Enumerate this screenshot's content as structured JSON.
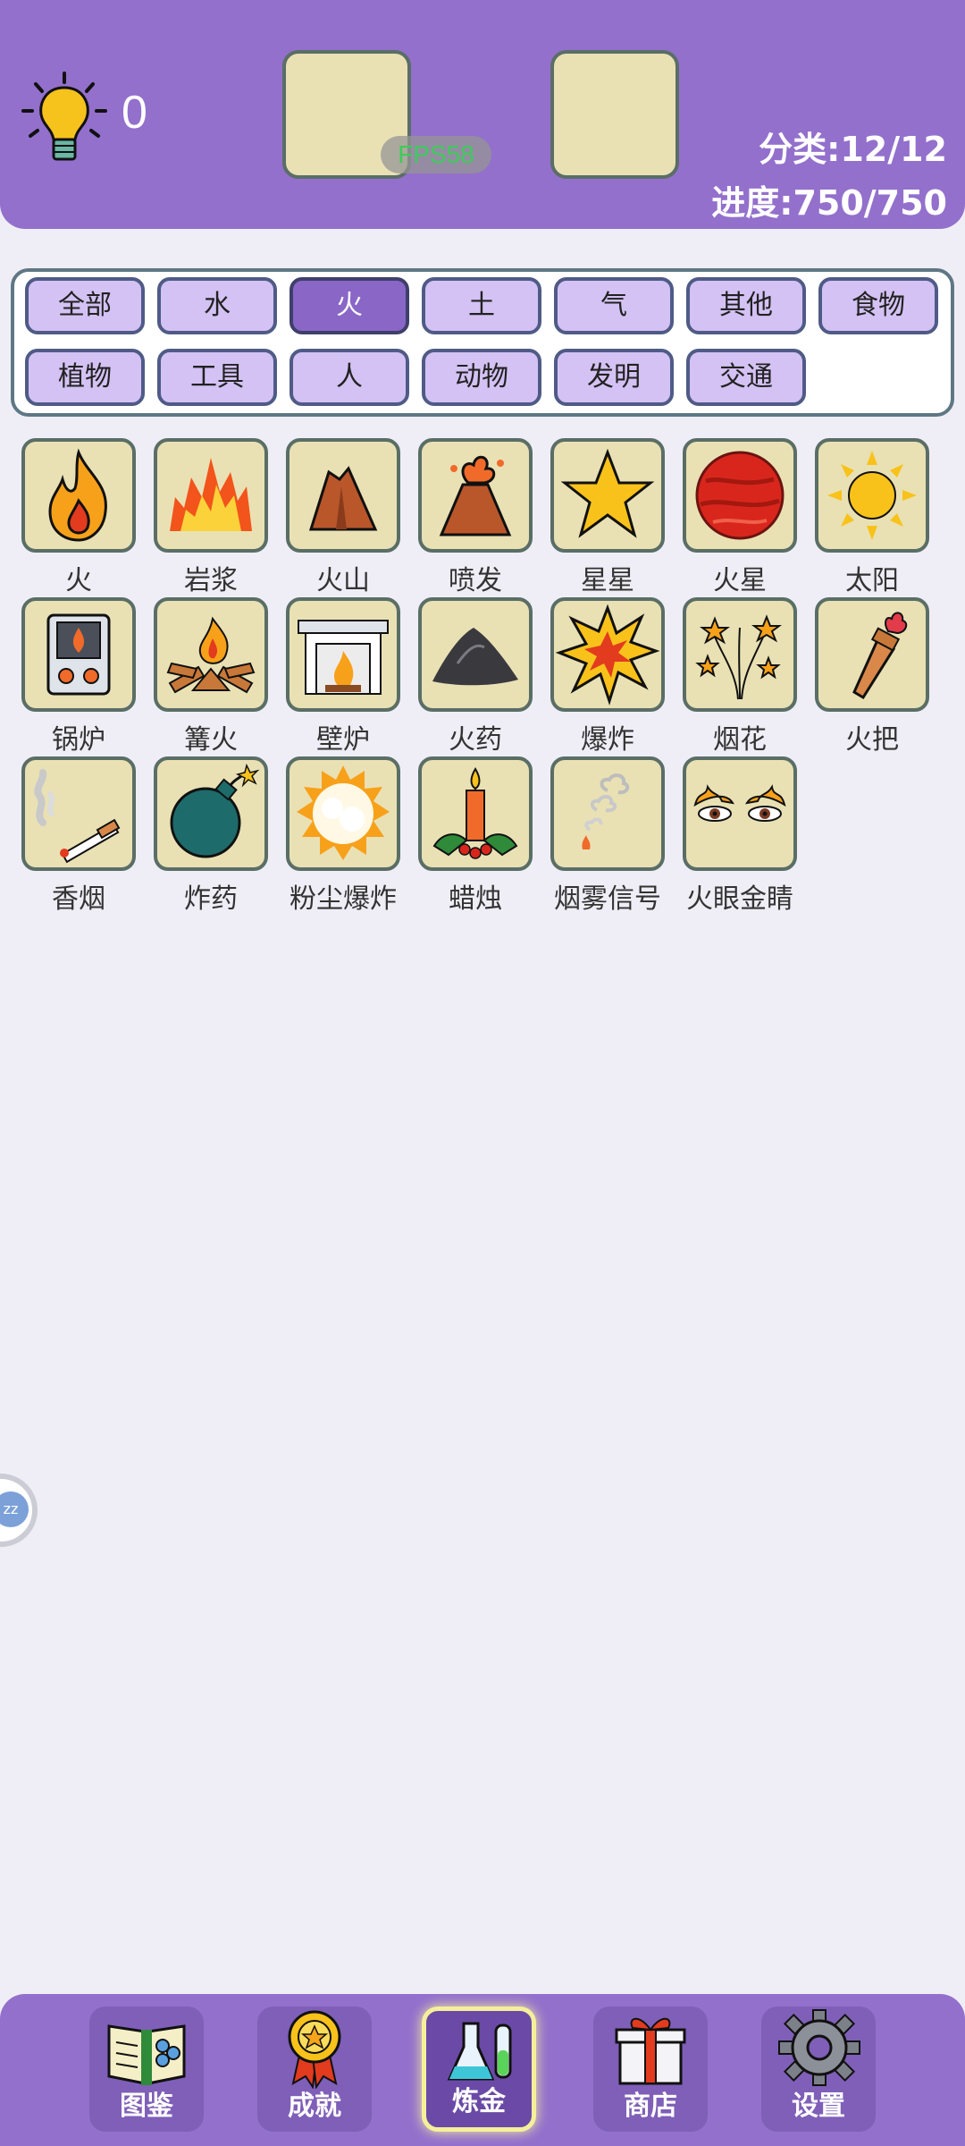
{
  "header": {
    "hint_count": "0",
    "fps": "FPS58",
    "category_stat": "分类:12/12",
    "progress_stat": "进度:750/750"
  },
  "filters": [
    {
      "label": "全部",
      "active": false
    },
    {
      "label": "水",
      "active": false
    },
    {
      "label": "火",
      "active": true
    },
    {
      "label": "土",
      "active": false
    },
    {
      "label": "气",
      "active": false
    },
    {
      "label": "其他",
      "active": false
    },
    {
      "label": "食物",
      "active": false
    },
    {
      "label": "植物",
      "active": false
    },
    {
      "label": "工具",
      "active": false
    },
    {
      "label": "人",
      "active": false
    },
    {
      "label": "动物",
      "active": false
    },
    {
      "label": "发明",
      "active": false
    },
    {
      "label": "交通",
      "active": false
    }
  ],
  "items": [
    {
      "label": "火",
      "icon": "fire-icon"
    },
    {
      "label": "岩浆",
      "icon": "lava-icon"
    },
    {
      "label": "火山",
      "icon": "volcano-icon"
    },
    {
      "label": "喷发",
      "icon": "eruption-icon"
    },
    {
      "label": "星星",
      "icon": "star-icon"
    },
    {
      "label": "火星",
      "icon": "mars-icon"
    },
    {
      "label": "太阳",
      "icon": "sun-icon"
    },
    {
      "label": "锅炉",
      "icon": "boiler-icon"
    },
    {
      "label": "篝火",
      "icon": "campfire-icon"
    },
    {
      "label": "壁炉",
      "icon": "fireplace-icon"
    },
    {
      "label": "火药",
      "icon": "gunpowder-icon"
    },
    {
      "label": "爆炸",
      "icon": "explosion-icon"
    },
    {
      "label": "烟花",
      "icon": "fireworks-icon"
    },
    {
      "label": "火把",
      "icon": "torch-icon"
    },
    {
      "label": "香烟",
      "icon": "cigarette-icon"
    },
    {
      "label": "炸药",
      "icon": "bomb-icon"
    },
    {
      "label": "粉尘爆炸",
      "icon": "dust-explosion-icon"
    },
    {
      "label": "蜡烛",
      "icon": "candle-icon"
    },
    {
      "label": "烟雾信号",
      "icon": "smoke-signal-icon"
    },
    {
      "label": "火眼金睛",
      "icon": "fire-eyes-icon"
    }
  ],
  "side_bubble": "zz",
  "nav": [
    {
      "label": "图鉴",
      "icon": "book-icon",
      "active": false
    },
    {
      "label": "成就",
      "icon": "medal-icon",
      "active": false
    },
    {
      "label": "炼金",
      "icon": "flask-icon",
      "active": true
    },
    {
      "label": "商店",
      "icon": "gift-icon",
      "active": false
    },
    {
      "label": "设置",
      "icon": "gear-icon",
      "active": false
    }
  ],
  "colors": {
    "header_bg": "#9370cc",
    "filter_active": "#8a66c7",
    "filter_inactive": "#d4c2f4",
    "tile_bg": "#e9e1b4",
    "fps_text": "#3ecb5a"
  }
}
